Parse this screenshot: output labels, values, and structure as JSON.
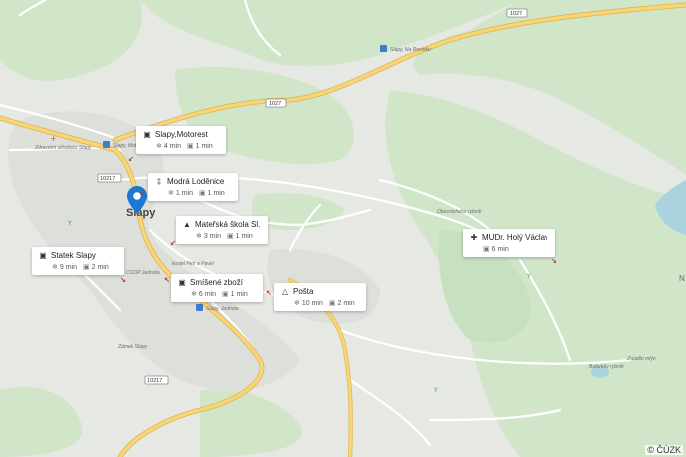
{
  "copyright": "© ČÚZK",
  "road_numbers": [
    "1027",
    "1027",
    "10217",
    "10217"
  ],
  "place_labels": {
    "village": "Slapy",
    "bus_stop_na_rovinku": "Slapy, Na Rovinku",
    "bus_stop_top": "Slapy, Moto...",
    "bus_stop_jednota": "Slapy, Jednota",
    "health_center": "Zdravotní středisko Slapy",
    "coop": "COOP Jednota",
    "church": "kostel Petr a Pavel",
    "castle": "Zámek Slapy",
    "obora": "Obecnicheho rybník",
    "zrcadlo": "Zrcadlo mlýn",
    "pond": "Bufarkův rybník",
    "edge_letter": "N"
  },
  "cards": [
    {
      "icon": "bus-icon",
      "title": "Slapy,Motorest",
      "walk": "4 min",
      "drive": "1 min"
    },
    {
      "icon": "restaurant-icon",
      "title": "Modrá Loděnice",
      "walk": "1 min",
      "drive": "1 min"
    },
    {
      "icon": "school-icon",
      "title": "Mateřská škola Sl...",
      "walk": "3 min",
      "drive": "1 min"
    },
    {
      "icon": "cart-icon",
      "title": "Statek Slapy",
      "walk": "9 min",
      "drive": "2 min"
    },
    {
      "icon": "cart-icon",
      "title": "Smíšené zboží",
      "walk": "6 min",
      "drive": "1 min"
    },
    {
      "icon": "post-icon",
      "title": "Pošta",
      "walk": "10 min",
      "drive": "2 min"
    },
    {
      "icon": "medical-icon",
      "title": "MUDr. Holý Václav",
      "walk": "",
      "drive": "6 min"
    }
  ],
  "colors": {
    "forest": "#cfe5c8",
    "background": "#e6e8e3",
    "road_main": "#f7d57b",
    "road_edge": "#e0b54a",
    "road_minor": "#ffffff",
    "water": "#aad3df",
    "pin": "#1e77d2",
    "arrow": "#c0392b"
  }
}
